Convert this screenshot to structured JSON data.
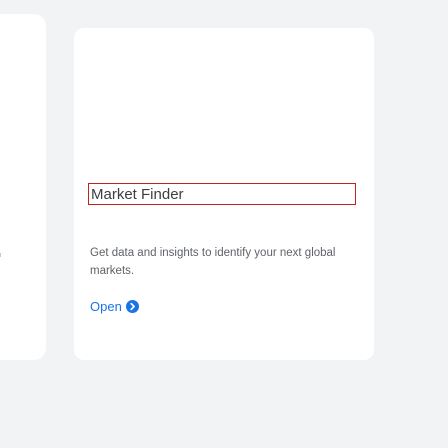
{
  "card": {
    "title": "Market Finder",
    "description": "Get data and insights to identify your next global markets.",
    "open_label": "Open",
    "open_icon": "arrow-circle-icon"
  },
  "colors": {
    "background": "#f1f3f4",
    "card": "#ffffff",
    "title_border": "#c5221f",
    "link": "#1a73e8",
    "title_text": "#3c4043",
    "body_text": "#5f6368"
  }
}
